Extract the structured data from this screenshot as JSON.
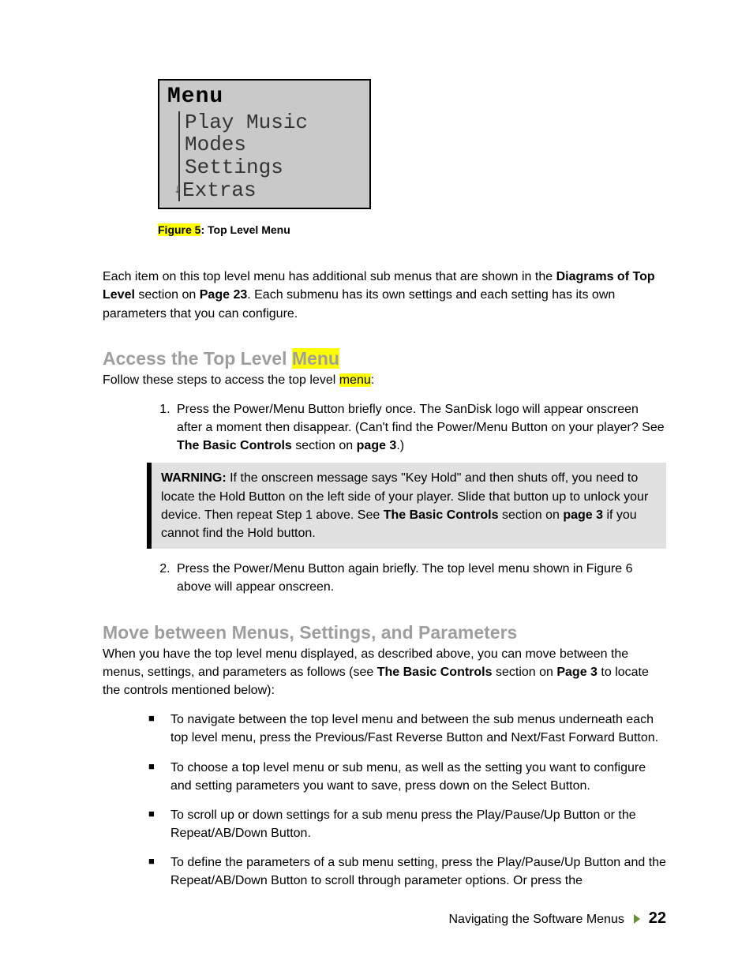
{
  "device_menu": {
    "title": "Menu",
    "items": [
      "Play Music",
      "Modes",
      "Settings",
      "Extras"
    ]
  },
  "caption": {
    "label_hl": "Figure 5",
    "rest": ": Top Level Menu"
  },
  "intro": {
    "t1": "Each item on this top level menu has additional sub menus that are shown in the ",
    "b1": "Diagrams of Top Level",
    "t2": "  section on ",
    "b2": "Page 23",
    "t3": ". Each submenu has its own settings and each setting has its own parameters that you can configure."
  },
  "section1": {
    "heading_pre": "Access the Top Level ",
    "heading_hl": "Menu",
    "lead_pre": "Follow these steps to access the top level ",
    "lead_hl": "menu",
    "lead_post": ":",
    "step1": {
      "t1": "Press the Power/Menu Button briefly once. The SanDisk logo will appear onscreen after a moment then disappear. (Can't find the Power/Menu Button on your player? See ",
      "b1": "The Basic Controls",
      "t2": " section on ",
      "b2": "page 3",
      "t3": ".)"
    },
    "warning": {
      "b1": "WARNING:",
      "t1": " If the onscreen message says \"Key Hold\" and then shuts off, you need to locate the Hold Button on the left side of your player. Slide that button up to unlock your device. Then repeat Step 1 above. See ",
      "b2": "The Basic Controls",
      "t2": " section on ",
      "b3": "page 3",
      "t3": " if you cannot find the Hold button."
    },
    "step2": "Press the Power/Menu Button again briefly. The top level menu shown in Figure 6 above will appear onscreen."
  },
  "section2": {
    "heading": "Move between Menus, Settings, and Parameters",
    "lead": {
      "t1": "When you have the top level menu displayed, as described above, you can move between the menus, settings, and parameters as follows (see ",
      "b1": "The Basic Controls",
      "t2": " section on ",
      "b2": "Page 3",
      "t3": " to locate the controls mentioned below):"
    },
    "bullets": [
      "To navigate between the top level menu and between the sub menus underneath each top level menu, press the Previous/Fast Reverse Button and Next/Fast Forward Button.",
      "To choose a top level menu or sub menu, as well as the setting you want to configure and setting parameters you want to save, press down on the Select Button.",
      "To scroll up or down settings for a sub menu press the Play/Pause/Up Button or the Repeat/AB/Down Button.",
      "To define the parameters of a sub menu setting, press the Play/Pause/Up Button and the Repeat/AB/Down Button to scroll through parameter options. Or press the"
    ]
  },
  "footer": {
    "text": "Navigating the Software Menus",
    "page": "22"
  }
}
